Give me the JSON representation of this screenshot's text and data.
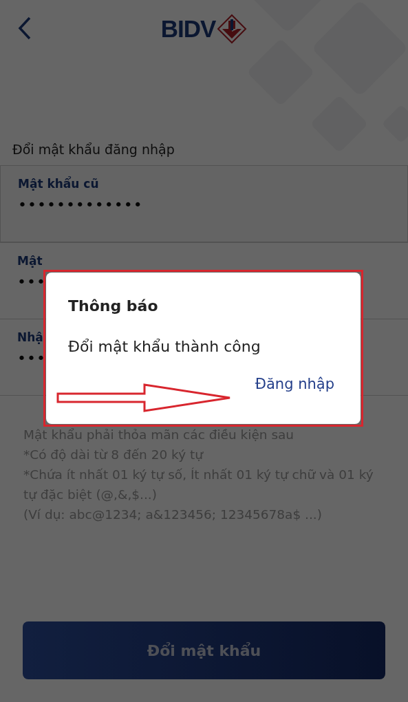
{
  "header": {
    "logo": "BIDV"
  },
  "title": "Đổi mật khẩu đăng nhập",
  "fields": [
    {
      "label": "Mật khẩu cũ",
      "value": "•••••••••••••"
    },
    {
      "label": "Mật",
      "value": "•••"
    },
    {
      "label": "Nhậ",
      "value": "•••"
    }
  ],
  "rules": [
    "Mật khẩu phải thỏa mãn các điều kiện sau",
    "*Có độ dài từ 8 đến 20 ký tự",
    "*Chứa ít nhất 01 ký tự số, Ít nhất 01 ký tự chữ và 01 ký tự đặc biệt (@,&,$...)",
    "(Ví dụ: abc@1234; a&123456; 12345678a$ ...)"
  ],
  "submit_button": {
    "label": "Đổi mật khẩu",
    "disabled": true
  },
  "dialog": {
    "title": "Thông báo",
    "message": "Đổi mật khẩu thành công",
    "action": "Đăng nhập"
  }
}
